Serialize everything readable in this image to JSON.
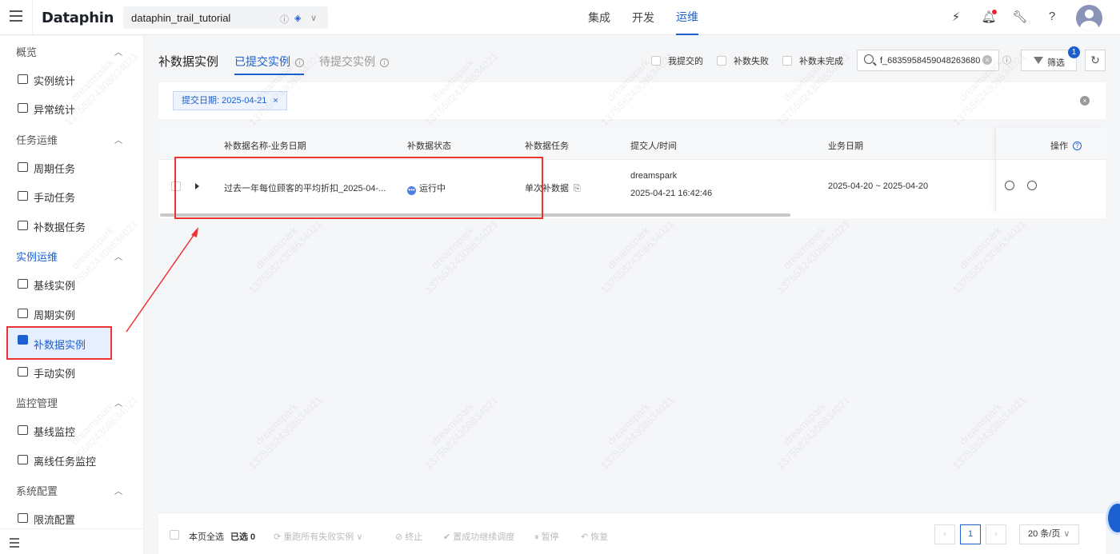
{
  "app": {
    "logo": "Dataphin",
    "project": "dataphin_trail_tutorial"
  },
  "top_nav": [
    "集成",
    "开发",
    "运维"
  ],
  "sidebar": {
    "groups": [
      {
        "label": "概览",
        "items": [
          "实例统计",
          "异常统计"
        ]
      },
      {
        "label": "任务运维",
        "items": [
          "周期任务",
          "手动任务",
          "补数据任务"
        ]
      },
      {
        "label": "实例运维",
        "items": [
          "基线实例",
          "周期实例",
          "补数据实例",
          "手动实例"
        ]
      },
      {
        "label": "监控管理",
        "items": [
          "基线监控",
          "离线任务监控"
        ]
      },
      {
        "label": "系统配置",
        "items": [
          "限流配置"
        ]
      }
    ]
  },
  "header": {
    "title": "补数据实例",
    "tabs": [
      "已提交实例",
      "待提交实例"
    ],
    "checkboxes": [
      "我提交的",
      "补数失败",
      "补数未完成"
    ],
    "search_value": "f_6835958459048263680",
    "filter_label": "筛选",
    "filter_badge": "1"
  },
  "filter_chip": {
    "label": "提交日期: 2025-04-21",
    "close": "×"
  },
  "table": {
    "columns": [
      "补数据名称-业务日期",
      "补数据状态",
      "补数据任务",
      "提交人/时间",
      "业务日期",
      "操作"
    ],
    "rows": [
      {
        "name": "过去一年每位顾客的平均折扣_2025-04-...",
        "status": "运行中",
        "task": "单次补数据",
        "submitter": "dreamspark",
        "submit_time": "2025-04-21 16:42:46",
        "biz_date": "2025-04-20 ~ 2025-04-20"
      }
    ]
  },
  "footer": {
    "select_all": "本页全选",
    "selected": "已选 0",
    "actions": [
      "重跑所有失败实例",
      "终止",
      "置成功继续调度",
      "暂停",
      "恢复"
    ],
    "page": "1",
    "page_size": "20 条/页"
  },
  "watermark": {
    "name": "dreamspark",
    "id": "13755824308634021"
  },
  "colors": {
    "accent": "#1b5fd1",
    "highlight": "#e33333"
  }
}
